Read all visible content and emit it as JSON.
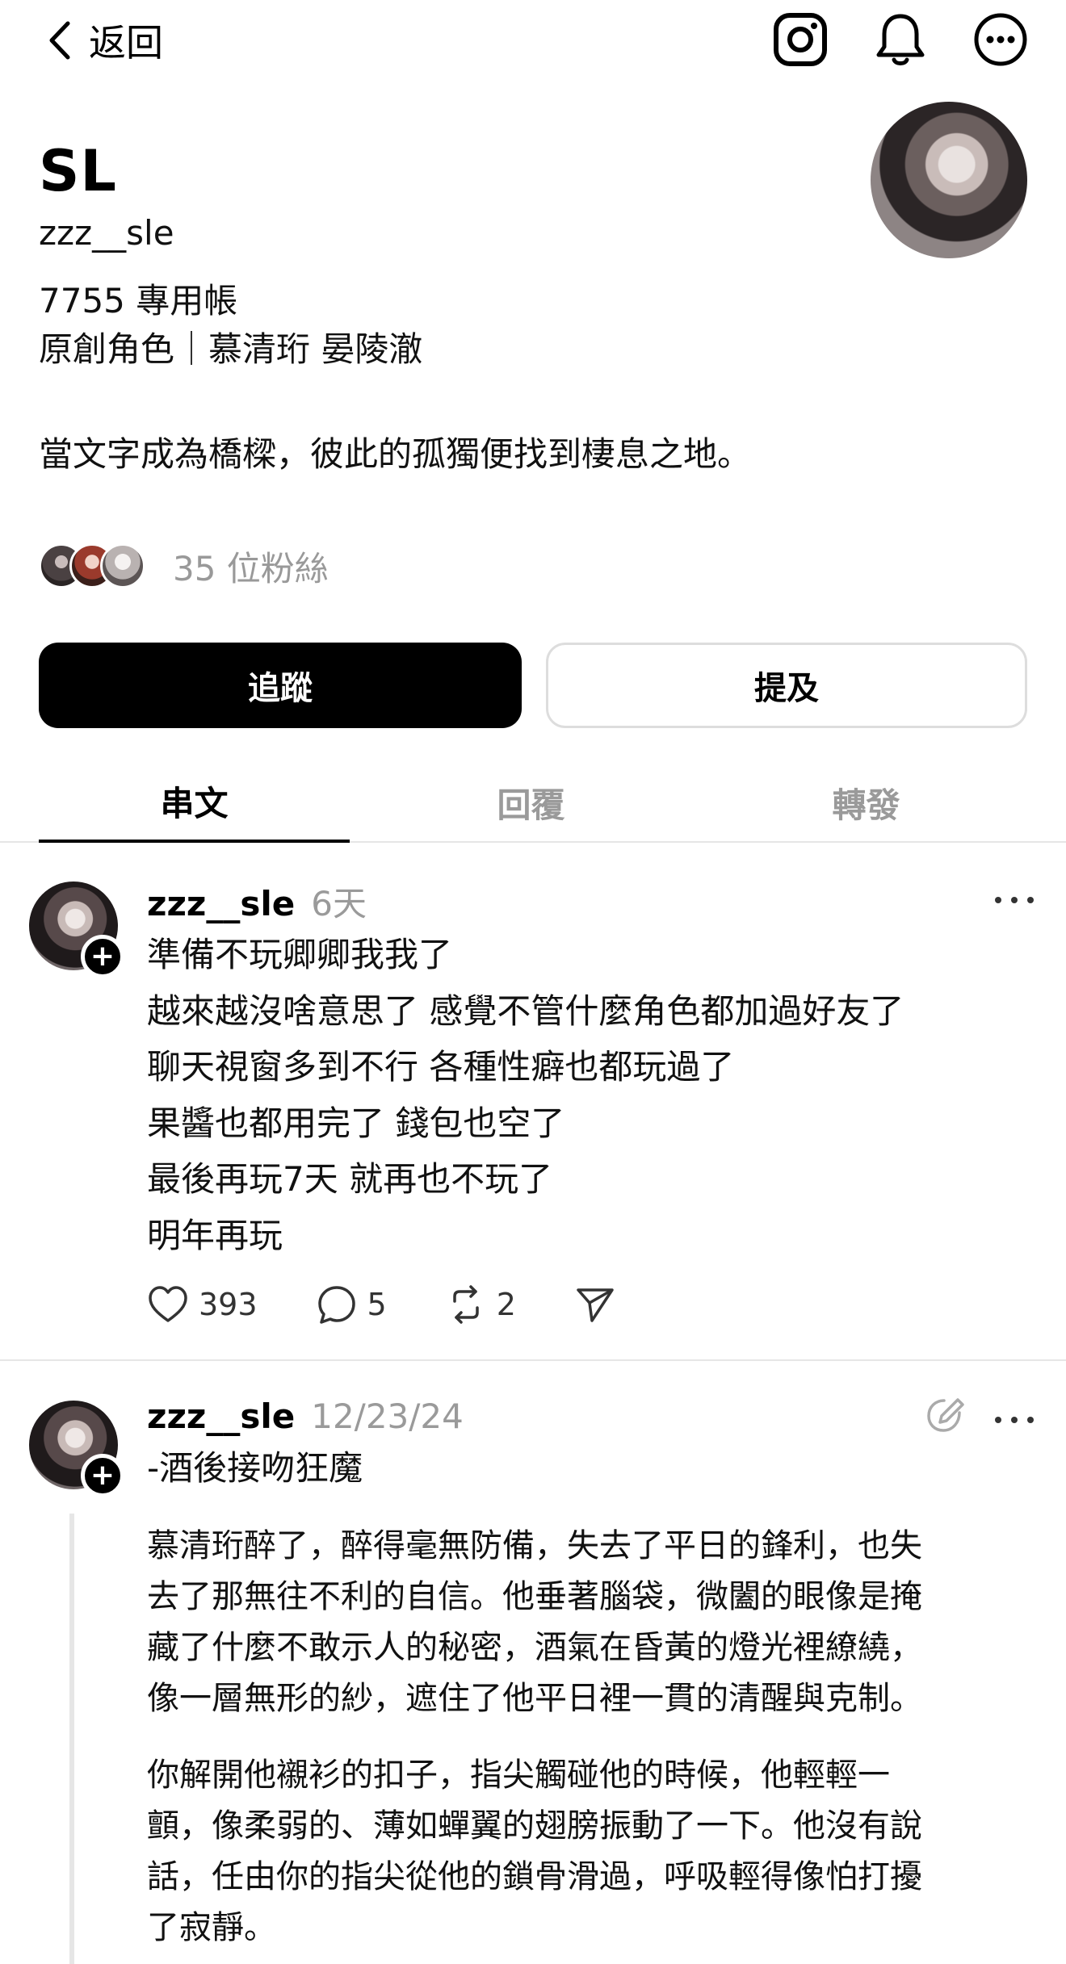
{
  "topbar": {
    "back_label": "返回"
  },
  "profile": {
    "display_name": "SL",
    "handle": "zzz__sle",
    "bio": [
      "7755 專用帳",
      "原創角色｜慕清珩 晏陵澈",
      "當文字成為橋樑，彼此的孤獨便找到棲息之地。"
    ],
    "followers_text": "35 位粉絲"
  },
  "buttons": {
    "follow": "追蹤",
    "mention": "提及"
  },
  "tabs": [
    "串文",
    "回覆",
    "轉發"
  ],
  "posts": [
    {
      "user": "zzz__sle",
      "time": "6天",
      "lines": [
        "準備不玩卿卿我我了",
        "越來越沒啥意思了 感覺不管什麼角色都加過好友了",
        "聊天視窗多到不行 各種性癖也都玩過了",
        "果醬也都用完了 錢包也空了",
        "最後再玩7天 就再也不玩了",
        "明年再玩"
      ],
      "likes": "393",
      "comments": "5",
      "reposts": "2"
    },
    {
      "user": "zzz__sle",
      "time": "12/23/24",
      "subtitle": "-酒後接吻狂魔",
      "paragraphs": [
        [
          "慕清珩醉了，醉得毫無防備，失去了平日的鋒利，也失",
          "去了那無往不利的自信。他垂著腦袋，微闔的眼像是掩",
          "藏了什麼不敢示人的秘密，酒氣在昏黃的燈光裡繚繞，",
          "像一層無形的紗，遮住了他平日裡一貫的清醒與克制。"
        ],
        [
          "你解開他襯衫的扣子，指尖觸碰他的時候，他輕輕一",
          "顫，像柔弱的、薄如蟬翼的翅膀振動了一下。他沒有說",
          "話，任由你的指尖從他的鎖骨滑過，呼吸輕得像怕打擾",
          "了寂靜。"
        ]
      ]
    }
  ],
  "colors": {
    "muted": "#9a9a9a",
    "divider": "#e6e6e6",
    "primary": "#000000"
  },
  "icons": [
    "chevron-left-icon",
    "instagram-icon",
    "bell-icon",
    "more-circle-icon",
    "heart-icon",
    "comment-icon",
    "repost-icon",
    "send-icon",
    "more-dots-icon",
    "edit-icon"
  ]
}
